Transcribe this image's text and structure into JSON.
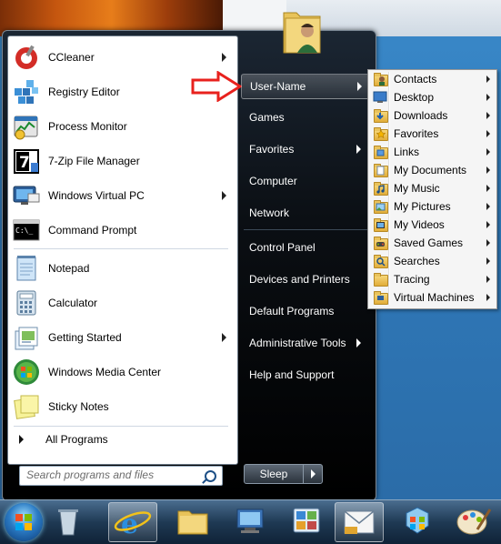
{
  "start_menu": {
    "pinned_programs": [
      {
        "label": "CCleaner",
        "icon": "ccleaner-icon",
        "has_submenu": true
      },
      {
        "label": "Registry Editor",
        "icon": "registry-editor-icon",
        "has_submenu": false
      },
      {
        "label": "Process Monitor",
        "icon": "process-monitor-icon",
        "has_submenu": false
      },
      {
        "label": "7-Zip File Manager",
        "icon": "7zip-icon",
        "has_submenu": false
      },
      {
        "label": "Windows Virtual PC",
        "icon": "virtual-pc-icon",
        "has_submenu": true
      },
      {
        "label": "Command Prompt",
        "icon": "command-prompt-icon",
        "has_submenu": false
      }
    ],
    "recent_programs": [
      {
        "label": "Notepad",
        "icon": "notepad-icon",
        "has_submenu": false
      },
      {
        "label": "Calculator",
        "icon": "calculator-icon",
        "has_submenu": false
      },
      {
        "label": "Getting Started",
        "icon": "getting-started-icon",
        "has_submenu": true
      },
      {
        "label": "Windows Media Center",
        "icon": "media-center-icon",
        "has_submenu": false
      },
      {
        "label": "Sticky Notes",
        "icon": "sticky-notes-icon",
        "has_submenu": false
      }
    ],
    "all_programs_label": "All Programs",
    "search": {
      "placeholder": "Search programs and files",
      "value": ""
    },
    "right_links": [
      {
        "label": "User-Name",
        "has_submenu": true,
        "highlighted": true
      },
      {
        "label": "Games",
        "has_submenu": false
      },
      {
        "label": "Favorites",
        "has_submenu": true
      },
      {
        "label": "Computer",
        "has_submenu": false
      },
      {
        "label": "Network",
        "has_submenu": false
      },
      {
        "label": "Control Panel",
        "has_submenu": false
      },
      {
        "label": "Devices and Printers",
        "has_submenu": false
      },
      {
        "label": "Default Programs",
        "has_submenu": false
      },
      {
        "label": "Administrative Tools",
        "has_submenu": true
      },
      {
        "label": "Help and Support",
        "has_submenu": false
      }
    ],
    "sleep_label": "Sleep"
  },
  "user_submenu": {
    "items": [
      {
        "label": "Contacts",
        "icon": "contacts-icon"
      },
      {
        "label": "Desktop",
        "icon": "desktop-folder-icon"
      },
      {
        "label": "Downloads",
        "icon": "downloads-folder-icon"
      },
      {
        "label": "Favorites",
        "icon": "favorites-folder-icon"
      },
      {
        "label": "Links",
        "icon": "links-folder-icon"
      },
      {
        "label": "My Documents",
        "icon": "documents-folder-icon"
      },
      {
        "label": "My Music",
        "icon": "music-folder-icon"
      },
      {
        "label": "My Pictures",
        "icon": "pictures-folder-icon"
      },
      {
        "label": "My Videos",
        "icon": "videos-folder-icon"
      },
      {
        "label": "Saved Games",
        "icon": "saved-games-folder-icon"
      },
      {
        "label": "Searches",
        "icon": "searches-folder-icon"
      },
      {
        "label": "Tracing",
        "icon": "folder-icon"
      },
      {
        "label": "Virtual Machines",
        "icon": "virtual-machines-folder-icon"
      }
    ]
  },
  "taskbar": {
    "buttons": [
      {
        "icon": "start-orb-icon"
      },
      {
        "icon": "recycle-bin-icon"
      },
      {
        "icon": "internet-explorer-icon",
        "active": true
      },
      {
        "icon": "file-explorer-icon"
      },
      {
        "icon": "computer-icon"
      },
      {
        "icon": "control-panel-icon"
      },
      {
        "icon": "outlook-icon",
        "active": true
      },
      {
        "icon": "network-icon"
      },
      {
        "icon": "paint-icon"
      }
    ]
  },
  "colors": {
    "annotation_arrow": "#e8211d",
    "menu_background": "#000000",
    "submenu_background": "#f5f5f5"
  }
}
